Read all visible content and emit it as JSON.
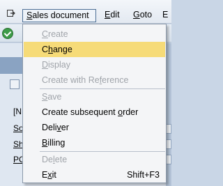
{
  "menubar": {
    "menus": [
      {
        "label_pre": "",
        "mnemonic": "S",
        "label_post": "ales document",
        "active": true
      },
      {
        "label_pre": "",
        "mnemonic": "E",
        "label_post": "dit",
        "active": false
      },
      {
        "label_pre": "",
        "mnemonic": "G",
        "label_post": "oto",
        "active": false
      },
      {
        "label_pre": "",
        "mnemonic": "E",
        "label_post": "",
        "active": false
      }
    ],
    "icon": "menu-exit-icon"
  },
  "background": {
    "ok_icon": "green-check-icon",
    "lines": [
      {
        "text": "[N",
        "underline": false
      },
      {
        "text": "So",
        "underline": true
      },
      {
        "text": "Sh",
        "underline": true
      },
      {
        "text": "PO",
        "underline": true
      }
    ]
  },
  "dropdown": {
    "items": [
      {
        "pre": "",
        "mn": "C",
        "post": "reate",
        "disabled": true,
        "shortcut": ""
      },
      {
        "pre": "C",
        "mn": "h",
        "post": "ange",
        "disabled": false,
        "highlighted": true,
        "shortcut": ""
      },
      {
        "pre": "",
        "mn": "D",
        "post": "isplay",
        "disabled": true,
        "shortcut": ""
      },
      {
        "pre": "Create with Re",
        "mn": "f",
        "post": "erence",
        "disabled": true,
        "shortcut": ""
      },
      {
        "pre": "",
        "mn": "S",
        "post": "ave",
        "disabled": true,
        "shortcut": ""
      },
      {
        "pre": "Create subsequent ",
        "mn": "o",
        "post": "rder",
        "disabled": false,
        "shortcut": ""
      },
      {
        "pre": "Deli",
        "mn": "v",
        "post": "er",
        "disabled": false,
        "shortcut": ""
      },
      {
        "pre": "",
        "mn": "B",
        "post": "illing",
        "disabled": false,
        "shortcut": ""
      },
      {
        "pre": "De",
        "mn": "l",
        "post": "ete",
        "disabled": true,
        "shortcut": ""
      },
      {
        "pre": "E",
        "mn": "x",
        "post": "it",
        "disabled": false,
        "shortcut": "Shift+F3"
      }
    ]
  }
}
